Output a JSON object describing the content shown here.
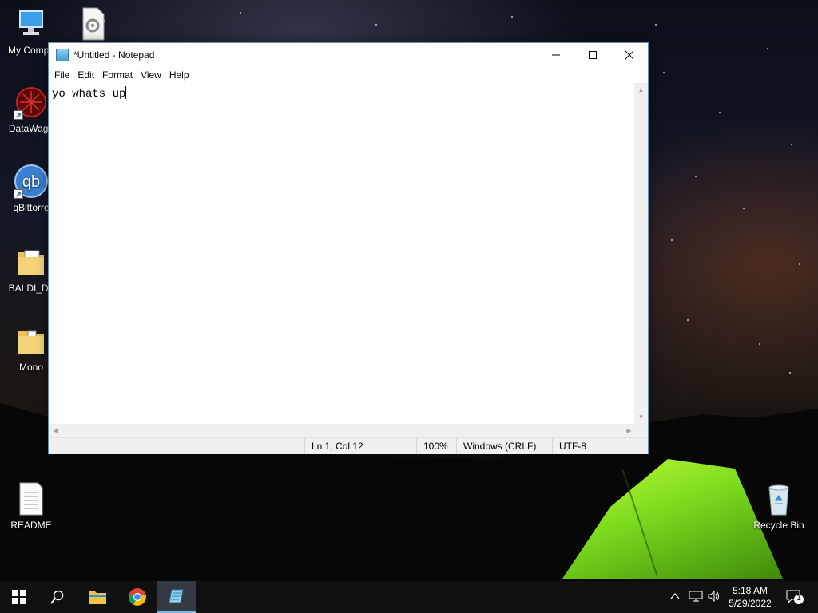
{
  "desktop": {
    "icons": [
      {
        "label": "My Compu",
        "icon": "computer-icon"
      },
      {
        "label": "",
        "icon": "settings-file-icon"
      },
      {
        "label": "DataWago",
        "icon": "datawagon-icon"
      },
      {
        "label": "qBittorre",
        "icon": "qbittorrent-icon"
      },
      {
        "label": "BALDI_Da",
        "icon": "folder-icon"
      },
      {
        "label": "Mono",
        "icon": "folder-icon"
      },
      {
        "label": "README",
        "icon": "text-document-icon"
      },
      {
        "label": "Recycle Bin",
        "icon": "recycle-bin-icon"
      }
    ],
    "qbittorrent_glyph": "qb"
  },
  "notepad": {
    "title": "*Untitled - Notepad",
    "controls": {
      "minimize": "—",
      "maximize": "☐",
      "close": "✕"
    },
    "menu": [
      "File",
      "Edit",
      "Format",
      "View",
      "Help"
    ],
    "content": "yo whats up",
    "status": {
      "position": "Ln 1, Col 12",
      "zoom": "100%",
      "line_ending": "Windows (CRLF)",
      "encoding": "UTF-8"
    }
  },
  "taskbar": {
    "apps": [
      "start-icon",
      "search-icon",
      "file-explorer-icon",
      "chrome-icon",
      "notepad-icon"
    ],
    "active_app": "notepad-icon",
    "tray": {
      "chevron": "^",
      "time": "5:18 AM",
      "date": "5/29/2022",
      "notification_count": "1"
    }
  },
  "colors": {
    "accent": "#76b9ed",
    "window_border": "#6b8db5",
    "tent": "#7ddb1e"
  }
}
